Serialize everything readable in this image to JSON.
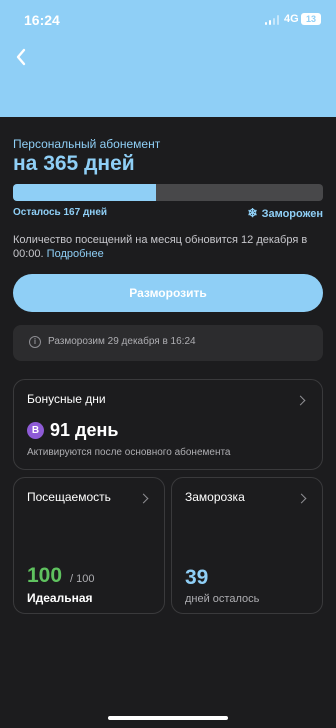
{
  "status_bar": {
    "time": "16:24",
    "network": "4G",
    "battery": "13"
  },
  "subscription": {
    "label": "Персональный абонемент",
    "title": "на 365 дней",
    "progress_percent": 46,
    "remaining": "Осталось 167 дней",
    "status": "Заморожен",
    "info_text": "Количество посещений на месяц обновится 12 декабря в 00:00.",
    "info_link": "Подробнее",
    "unfreeze_button": "Разморозить",
    "notice": "Разморозим 29 декабря в 16:24"
  },
  "bonus": {
    "title": "Бонусные дни",
    "badge": "B",
    "value": "91 день",
    "note": "Активируются после основного абонемента"
  },
  "attendance": {
    "title": "Посещаемость",
    "value": "100",
    "total": "/ 100",
    "label": "Идеальная"
  },
  "freeze": {
    "title": "Заморозка",
    "value": "39",
    "label": "дней осталось"
  },
  "colors": {
    "accent": "#8fcff6",
    "success": "#5fc25f",
    "bonus_badge": "#8e5bd6"
  }
}
